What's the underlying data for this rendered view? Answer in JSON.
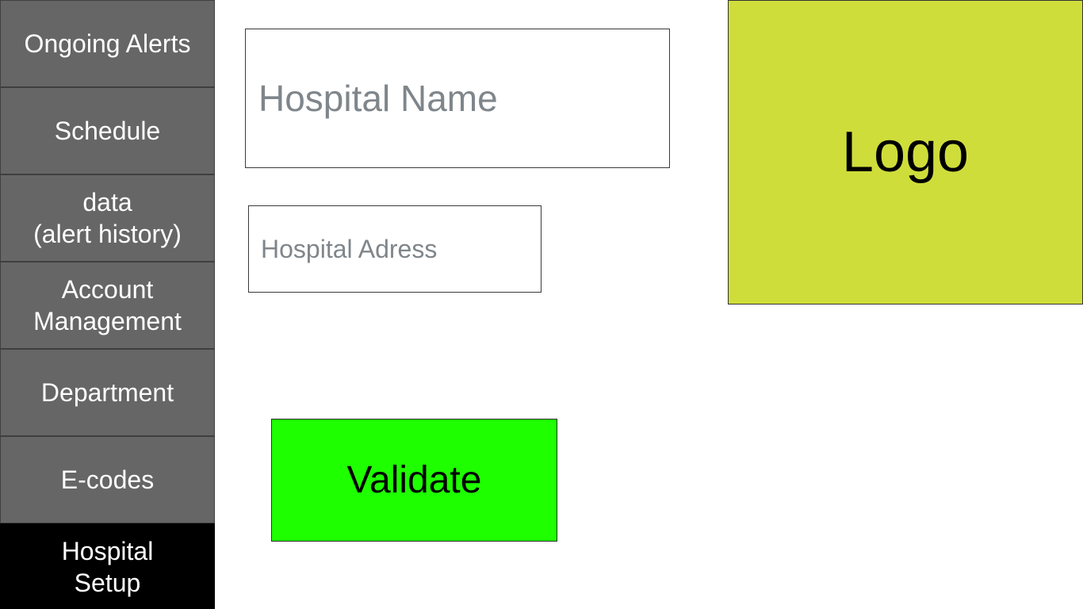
{
  "sidebar": {
    "items": [
      {
        "label": "Ongoing Alerts",
        "active": false
      },
      {
        "label": "Schedule",
        "active": false
      },
      {
        "label": "data\n(alert history)",
        "active": false
      },
      {
        "label": "Account\nManagement",
        "active": false
      },
      {
        "label": "Department",
        "active": false
      },
      {
        "label": "E-codes",
        "active": false
      },
      {
        "label": "Hospital\nSetup",
        "active": true
      }
    ]
  },
  "form": {
    "hospital_name": {
      "value": "",
      "placeholder": "Hospital Name"
    },
    "hospital_address": {
      "value": "",
      "placeholder": "Hospital Adress"
    },
    "validate_label": "Validate"
  },
  "logo": {
    "label": "Logo"
  },
  "colors": {
    "sidebar_bg": "#666666",
    "sidebar_active_bg": "#000000",
    "logo_bg": "#cfdd3b",
    "validate_bg": "#1eff00",
    "placeholder_text": "#7f868b"
  }
}
